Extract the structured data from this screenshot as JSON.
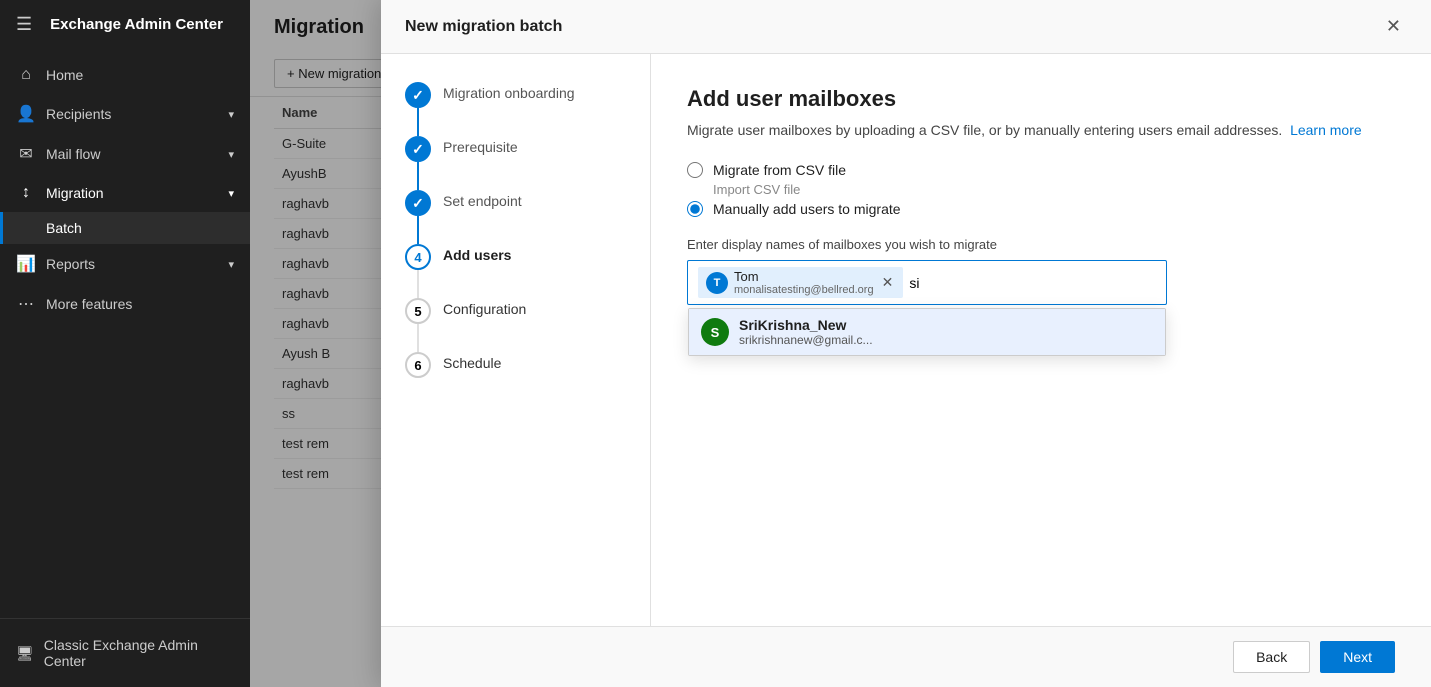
{
  "app": {
    "title": "Exchange Admin Center",
    "hamburger": "☰"
  },
  "sidebar": {
    "items": [
      {
        "id": "home",
        "label": "Home",
        "icon": "⌂",
        "hasChevron": false
      },
      {
        "id": "recipients",
        "label": "Recipients",
        "icon": "👤",
        "hasChevron": true
      },
      {
        "id": "mail-flow",
        "label": "Mail flow",
        "icon": "✉",
        "hasChevron": true
      },
      {
        "id": "migration",
        "label": "Migration",
        "icon": "↕",
        "hasChevron": true
      },
      {
        "id": "reports",
        "label": "Reports",
        "icon": "📊",
        "hasChevron": true
      },
      {
        "id": "more-features",
        "label": "More features",
        "icon": "⋯",
        "hasChevron": false
      }
    ],
    "sub_items": [
      {
        "id": "batch",
        "label": "Batch",
        "parent": "migration",
        "active": true
      }
    ],
    "bottom_items": [
      {
        "id": "classic",
        "label": "Classic Exchange Admin Center",
        "icon": "🖥"
      }
    ]
  },
  "main": {
    "title": "Migration",
    "toolbar": {
      "new_migration_label": "+ New migration batch"
    },
    "table": {
      "columns": [
        "Name"
      ],
      "rows": [
        {
          "name": "G-Suite"
        },
        {
          "name": "AyushB"
        },
        {
          "name": "raghavb"
        },
        {
          "name": "raghavb"
        },
        {
          "name": "raghavb"
        },
        {
          "name": "raghavb"
        },
        {
          "name": "raghavb"
        },
        {
          "name": "Ayush B"
        },
        {
          "name": "raghavb"
        },
        {
          "name": "ss"
        },
        {
          "name": "test rem"
        },
        {
          "name": "test rem"
        }
      ]
    }
  },
  "modal": {
    "title": "New migration batch",
    "close_icon": "✕",
    "wizard": {
      "steps": [
        {
          "id": "migration-onboarding",
          "label": "Migration onboarding",
          "state": "completed"
        },
        {
          "id": "prerequisite",
          "label": "Prerequisite",
          "state": "completed"
        },
        {
          "id": "set-endpoint",
          "label": "Set endpoint",
          "state": "completed"
        },
        {
          "id": "add-users",
          "label": "Add users",
          "state": "current"
        },
        {
          "id": "configuration",
          "label": "Configuration",
          "state": "upcoming"
        },
        {
          "id": "schedule",
          "label": "Schedule",
          "state": "upcoming"
        }
      ]
    },
    "content": {
      "title": "Add user mailboxes",
      "description": "Migrate user mailboxes by uploading a CSV file, or by manually entering users email addresses.",
      "learn_more": "Learn more",
      "radio_options": [
        {
          "id": "csv",
          "label": "Migrate from CSV file",
          "sub_label": "Import CSV file",
          "checked": false
        },
        {
          "id": "manual",
          "label": "Manually add users to migrate",
          "sub_label": "",
          "checked": true
        }
      ],
      "input_label": "Enter display names of mailboxes you wish to migrate",
      "current_tags": [
        {
          "id": "tom",
          "avatar_letter": "T",
          "avatar_color": "#0078d4",
          "name": "Tom",
          "email": "monalisatesting@bellred.org"
        }
      ],
      "input_value": "si",
      "suggestion": {
        "avatar_letter": "S",
        "avatar_color": "#0f7b0f",
        "name": "SriKrishna_New",
        "email": "srikrishnanew@gmail.c..."
      }
    },
    "footer": {
      "back_label": "Back",
      "next_label": "Next"
    }
  }
}
